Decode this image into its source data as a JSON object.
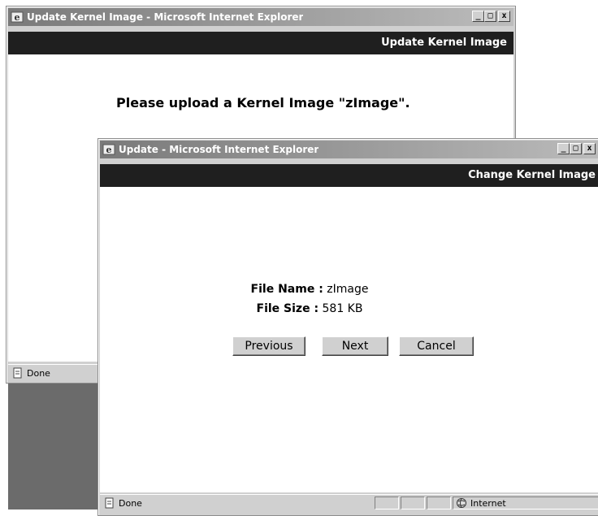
{
  "back_window": {
    "title": "Update Kernel Image - Microsoft Internet Explorer",
    "banner": "Update Kernel Image",
    "message": "Please upload a Kernel Image \"zImage\".",
    "status_text": "Done",
    "controls": {
      "minimize": "_",
      "maximize": "□",
      "close": "x"
    }
  },
  "front_window": {
    "title": "Update - Microsoft Internet Explorer",
    "banner": "Change Kernel Image",
    "file_name_label": "File Name :",
    "file_name_value": "zImage",
    "file_size_label": "File Size :",
    "file_size_value": "581 KB",
    "buttons": {
      "previous": "Previous",
      "next": "Next",
      "cancel": "Cancel"
    },
    "status_text": "Done",
    "zone_text": "Internet",
    "controls": {
      "minimize": "_",
      "maximize": "□",
      "close": "x"
    }
  },
  "colors": {
    "banner": "#1f1f1f",
    "chrome": "#d4d0c8",
    "desktop": "#6b6b6b"
  }
}
